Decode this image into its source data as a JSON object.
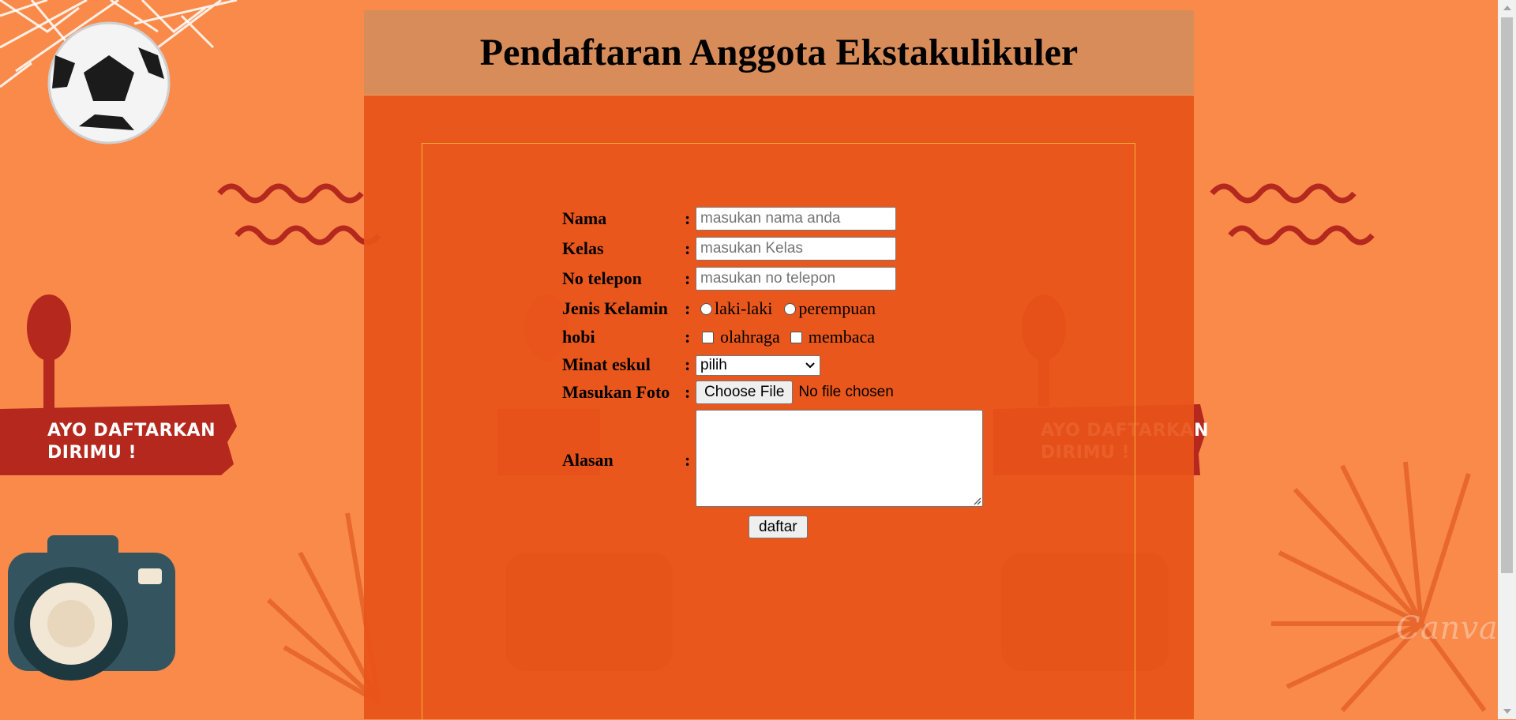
{
  "header": {
    "title": "Pendaftaran Anggota Ekstakulikuler"
  },
  "background": {
    "banner_text_line1": "AYO DAFTARKAN",
    "banner_text_line2": "DIRIMU !",
    "watermark": "Canva"
  },
  "form": {
    "separator": ":",
    "nama": {
      "label": "Nama",
      "placeholder": "masukan nama anda"
    },
    "kelas": {
      "label": "Kelas",
      "placeholder": "masukan Kelas"
    },
    "telepon": {
      "label": "No telepon",
      "placeholder": "masukan no telepon"
    },
    "jenis_kelamin": {
      "label": "Jenis Kelamin",
      "options": [
        "laki-laki",
        "perempuan"
      ]
    },
    "hobi": {
      "label": "hobi",
      "options": [
        "olahraga",
        "membaca"
      ]
    },
    "minat": {
      "label": "Minat eskul",
      "selected": "pilih"
    },
    "foto": {
      "label": "Masukan Foto",
      "button_label": "Choose File",
      "status": "No file chosen"
    },
    "alasan": {
      "label": "Alasan"
    },
    "submit_label": "daftar"
  },
  "colors": {
    "page_bg": "#f98a4a",
    "panel_bg": "#e85319",
    "header_bg": "#d78c59",
    "frame_border": "#f3b23a",
    "banner_red": "#b5281e"
  }
}
